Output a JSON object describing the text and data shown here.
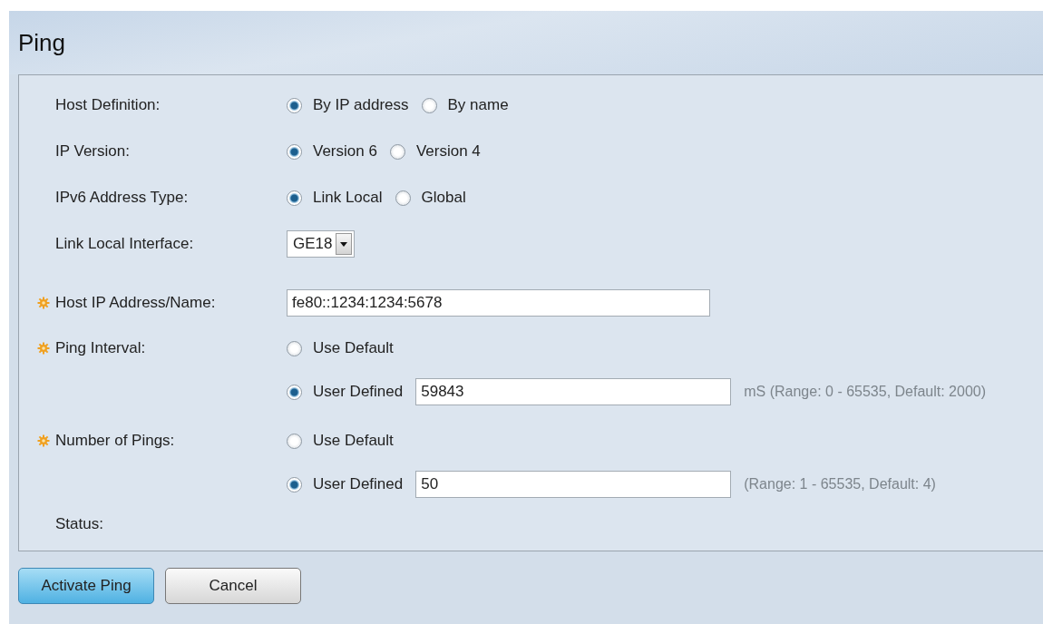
{
  "title": "Ping",
  "fields": [
    {
      "kind": "radio",
      "label": "Host Definition:",
      "required": false,
      "options": [
        {
          "label": "By IP address",
          "selected": true
        },
        {
          "label": "By name",
          "selected": false
        }
      ]
    },
    {
      "kind": "radio",
      "label": "IP Version:",
      "required": false,
      "options": [
        {
          "label": "Version 6",
          "selected": true
        },
        {
          "label": "Version 4",
          "selected": false
        }
      ]
    },
    {
      "kind": "radio",
      "label": "IPv6 Address Type:",
      "required": false,
      "options": [
        {
          "label": "Link Local",
          "selected": true
        },
        {
          "label": "Global",
          "selected": false
        }
      ]
    },
    {
      "kind": "select",
      "label": "Link Local Interface:",
      "required": false,
      "value": "GE18"
    },
    {
      "kind": "text",
      "label": "Host IP Address/Name:",
      "required": true,
      "value": "fe80::1234:1234:5678"
    },
    {
      "kind": "choice",
      "label": "Ping Interval:",
      "required": true,
      "options": [
        {
          "label": "Use Default",
          "selected": false
        },
        {
          "label": "User Defined",
          "selected": true,
          "value": "59843",
          "hint": "mS (Range: 0 - 65535, Default: 2000)"
        }
      ]
    },
    {
      "kind": "choice",
      "label": "Number of Pings:",
      "required": true,
      "options": [
        {
          "label": "Use Default",
          "selected": false
        },
        {
          "label": "User Defined",
          "selected": true,
          "value": "50",
          "hint": "(Range: 1 - 65535, Default: 4)"
        }
      ]
    },
    {
      "kind": "status",
      "label": "Status:",
      "required": false
    }
  ],
  "buttons": [
    {
      "label": "Activate Ping",
      "primary": true
    },
    {
      "label": "Cancel",
      "primary": false
    }
  ]
}
